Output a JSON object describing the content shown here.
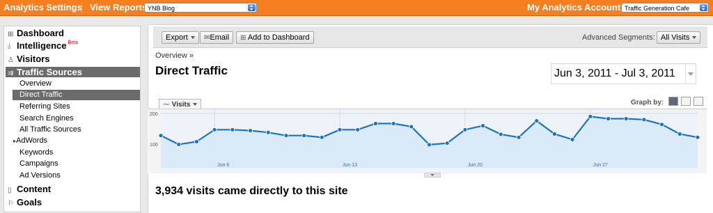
{
  "topbar": {
    "settings_label": "Analytics Settings",
    "view_reports_label": "View Reports:",
    "profile_select": "YNB Blog",
    "accounts_label": "My Analytics Accounts:",
    "account_select": "Traffic Generation Cafe",
    "color": "#f77f20"
  },
  "sidebar": {
    "items": [
      {
        "label": "Dashboard",
        "icon": "grid-icon"
      },
      {
        "label": "Intelligence",
        "badge": "Beta",
        "icon": "intelligence-icon"
      },
      {
        "label": "Visitors",
        "icon": "person-icon"
      },
      {
        "label": "Traffic Sources",
        "icon": "traffic-icon"
      },
      {
        "label": "Content",
        "icon": "page-icon"
      },
      {
        "label": "Goals",
        "icon": "flag-icon"
      }
    ],
    "traffic_sub": [
      "Overview",
      "Direct Traffic",
      "Referring Sites",
      "Search Engines",
      "All Traffic Sources",
      "AdWords",
      "Keywords",
      "Campaigns",
      "Ad Versions"
    ]
  },
  "toolbar": {
    "export_label": "Export",
    "email_label": "Email",
    "dashboard_label": "Add to Dashboard",
    "segments_label": "Advanced Segments:",
    "segments_value": "All Visits"
  },
  "page": {
    "breadcrumb": "Overview »",
    "title": "Direct Traffic",
    "date_range": "Jun 3, 2011 - Jul 3, 2011",
    "metric_tab": "Visits",
    "graph_by_label": "Graph by:",
    "summary": "3,934 visits came directly to this site"
  },
  "chart_data": {
    "type": "area",
    "x": [
      "Jun 3",
      "Jun 4",
      "Jun 5",
      "Jun 6",
      "Jun 7",
      "Jun 8",
      "Jun 9",
      "Jun 10",
      "Jun 11",
      "Jun 12",
      "Jun 13",
      "Jun 14",
      "Jun 15",
      "Jun 16",
      "Jun 17",
      "Jun 18",
      "Jun 19",
      "Jun 20",
      "Jun 21",
      "Jun 22",
      "Jun 23",
      "Jun 24",
      "Jun 25",
      "Jun 26",
      "Jun 27",
      "Jun 28",
      "Jun 29",
      "Jun 30",
      "Jul 1",
      "Jul 2",
      "Jul 3"
    ],
    "values": [
      128,
      99,
      108,
      147,
      147,
      144,
      138,
      128,
      128,
      122,
      147,
      147,
      167,
      167,
      157,
      98,
      103,
      147,
      160,
      132,
      122,
      176,
      133,
      115,
      190,
      183,
      183,
      180,
      164,
      133,
      122
    ],
    "y_ticks": [
      100,
      200
    ],
    "x_tick_labels": [
      "Jun 6",
      "Jun 13",
      "Jun 20",
      "Jun 27"
    ],
    "ylim": [
      0,
      200
    ],
    "line_color": "#1a73c8",
    "fill_color": "#dbeaf8"
  }
}
